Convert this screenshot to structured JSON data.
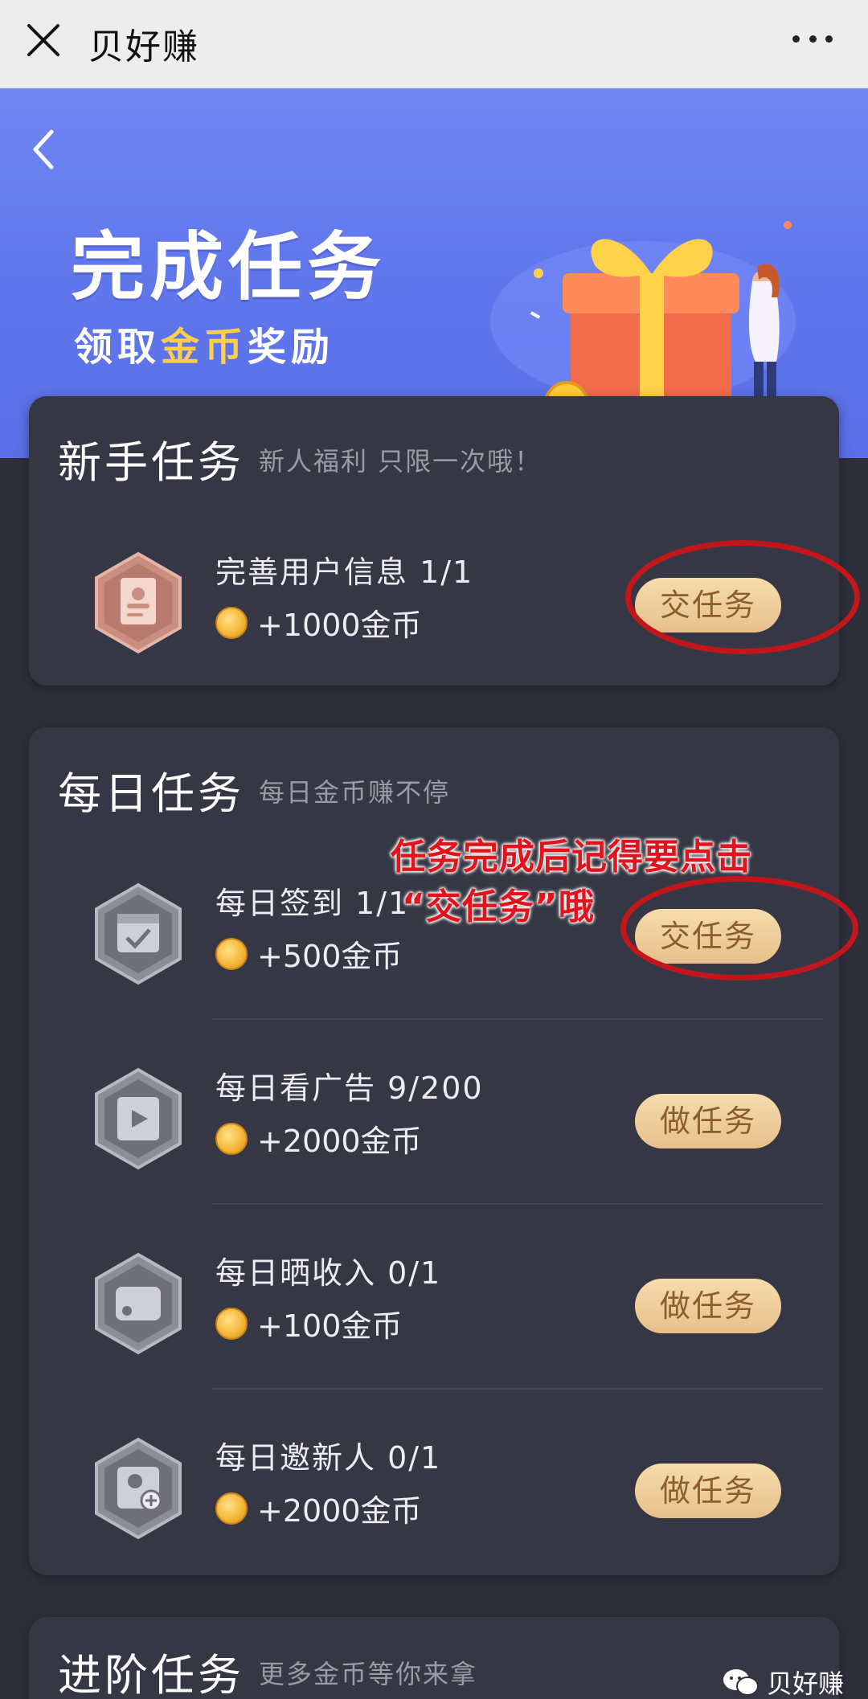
{
  "window": {
    "title": "贝好赚"
  },
  "hero": {
    "title": "完成任务",
    "subtitle": {
      "part1": "领取",
      "highlight": "金币",
      "part2": "奖励"
    }
  },
  "colors": {
    "accent_button": "#e7c08c",
    "annotation_red": "#e0141c",
    "banner_blue": "#6f86f2",
    "card_bg": "#363744"
  },
  "sections": {
    "newbie": {
      "title": "新手任务",
      "subtitle": "新人福利 只限一次哦！",
      "tasks": [
        {
          "name": "完善用户信息 1/1",
          "reward": "+1000金币",
          "button": "交任务",
          "icon": "id-card-icon"
        }
      ]
    },
    "daily": {
      "title": "每日任务",
      "subtitle": "每日金币赚不停",
      "tasks": [
        {
          "name": "每日签到 1/1",
          "reward": "+500金币",
          "button": "交任务",
          "icon": "calendar-check-icon"
        },
        {
          "name": "每日看广告 9/200",
          "reward": "+2000金币",
          "button": "做任务",
          "icon": "video-icon"
        },
        {
          "name": "每日晒收入 0/1",
          "reward": "+100金币",
          "button": "做任务",
          "icon": "wallet-icon"
        },
        {
          "name": "每日邀新人 0/1",
          "reward": "+2000金币",
          "button": "做任务",
          "icon": "invite-user-icon"
        }
      ]
    },
    "advanced": {
      "title": "进阶任务",
      "subtitle": "更多金币等你来拿"
    }
  },
  "annotation": {
    "line1": "任务完成后记得要点击",
    "line2": "“交任务”哦"
  },
  "watermark": {
    "text": "贝好赚"
  }
}
